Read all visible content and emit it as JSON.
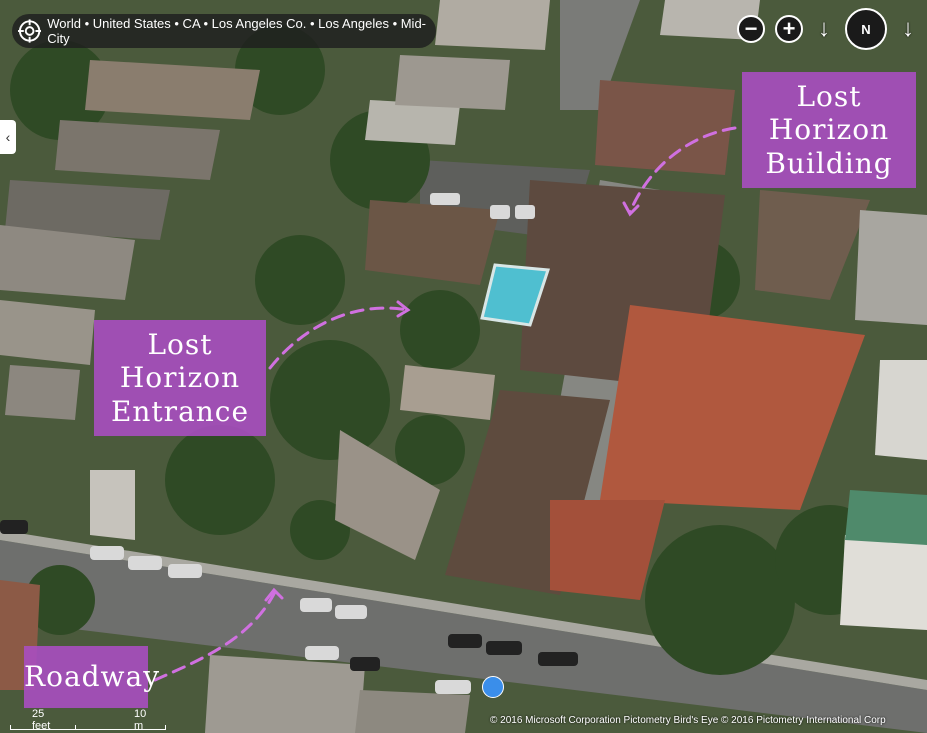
{
  "breadcrumb": {
    "text": "World • United States • CA • Los Angeles Co. • Los Angeles • Mid-City"
  },
  "controls": {
    "zoom_out": "−",
    "zoom_in": "+",
    "compass": "N",
    "rotate_left": "↓",
    "rotate_right": "↓"
  },
  "sidebar": {
    "toggle": "‹"
  },
  "labels": {
    "building_line1": "Lost Horizon",
    "building_line2": "Building",
    "entrance_line1": "Lost Horizon",
    "entrance_line2": "Entrance",
    "roadway": "Roadway"
  },
  "scale": {
    "feet": "25 feet",
    "meters": "10 m"
  },
  "copyright": "© 2016 Microsoft Corporation    Pictometry Bird's Eye © 2016 Pictometry International Corp",
  "colors": {
    "label_bg": "#a84ec0",
    "annotation_dash": "#d070e0",
    "location_dot": "#3a8eea"
  }
}
